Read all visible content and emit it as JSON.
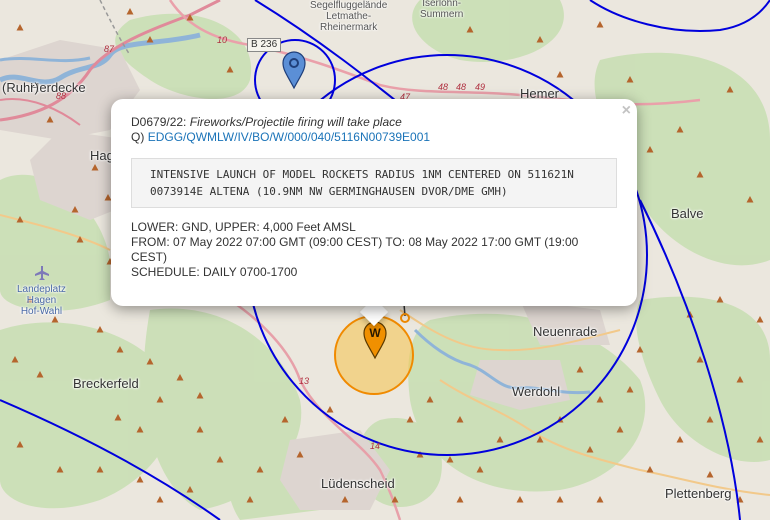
{
  "map": {
    "places": {
      "herdecke": "Herdecke",
      "ruhr": "(Ruhr)",
      "hagen_short": "Hag",
      "segelfluggelaende": "Segelfluggelände\nLetmathe-\nRheinermark",
      "iserlohn": "Iserlohn-\nSummern",
      "hemer": "Hemer",
      "balve": "Balve",
      "neuenrade": "Neuenrade",
      "werdohl": "Werdohl",
      "breckerfeld": "Breckerfeld",
      "luedenscheid": "Lüdenscheid",
      "plettenberg": "Plettenberg",
      "landeplatz": "Landeplatz\nHagen\nHof-Wahl"
    },
    "roads": {
      "b236": "B 236",
      "r10": "10",
      "r87": "87",
      "r88": "88",
      "r48": "48",
      "r48b": "48",
      "r49": "49",
      "r47": "47",
      "r13": "13",
      "r14": "14"
    },
    "colors": {
      "airspace_ring": "#0000dd",
      "warning_fill": "#f6c24a",
      "warning_stroke": "#f08a00",
      "marker_blue": "#5b8fd6",
      "marker_orange": "#f09000"
    },
    "markers": {
      "blue": {
        "icon": "map-pin-icon",
        "glyph": "O"
      },
      "warning": {
        "icon": "warning-pin-icon",
        "glyph": "W"
      }
    }
  },
  "popup": {
    "id": "D0679/22:",
    "title": "Fireworks/Projectile firing will take place",
    "q_prefix": "Q)",
    "q_link": "EDGG/QWMLW/IV/BO/W/000/040/5116N00739E001",
    "text_line1": "INTENSIVE LAUNCH OF MODEL ROCKETS RADIUS 1NM CENTERED ON 511621N",
    "text_line2": "0073914E ALTENA (10.9NM NW GERMINGHAUSEN DVOR/DME GMH)",
    "limits": "LOWER: GND, UPPER: 4,000 Feet AMSL",
    "period": "FROM: 07 May 2022 07:00 GMT (09:00 CEST) TO: 08 May 2022 17:00 GMT (19:00 CEST)",
    "schedule": "SCHEDULE: DAILY 0700-1700",
    "close_label": "×"
  }
}
